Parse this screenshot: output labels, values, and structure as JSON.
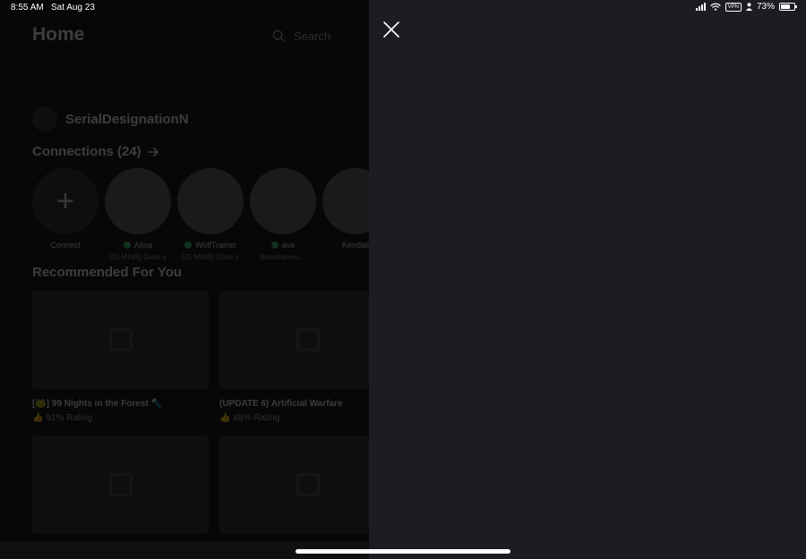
{
  "status_bar": {
    "time": "8:55 AM",
    "date": "Sat Aug 23",
    "vpn": "VPN",
    "battery_text": "73%",
    "battery_level": 0.73
  },
  "app": {
    "page_title": "Home",
    "search_placeholder": "Search",
    "username": "SerialDesignationN",
    "connections_title": "Connections (24)",
    "connect_label": "Connect",
    "friends": [
      {
        "name": "Alina",
        "status": "[15 MINS] Grow a",
        "online": true
      },
      {
        "name": "WolfTrainer",
        "status": "[15 MINS] Grow a",
        "online": true
      },
      {
        "name": "ave",
        "status": "Brookhaven…",
        "online": true
      },
      {
        "name": "Kendall",
        "status": "",
        "online": false
      }
    ],
    "recommended_title": "Recommended For You",
    "games": [
      {
        "name": "[🐸] 99 Nights in the Forest 🔦",
        "rating": "91% Rating"
      },
      {
        "name": "(UPDATE 6) Artificial Warfare",
        "rating": "88% Rating"
      },
      {
        "name": "",
        "rating": ""
      },
      {
        "name": "",
        "rating": ""
      }
    ]
  },
  "panel": {
    "close_icon": "close-icon"
  },
  "colors": {
    "panel_bg": "#1d1c22",
    "online_dot": "#3fbf6e"
  }
}
